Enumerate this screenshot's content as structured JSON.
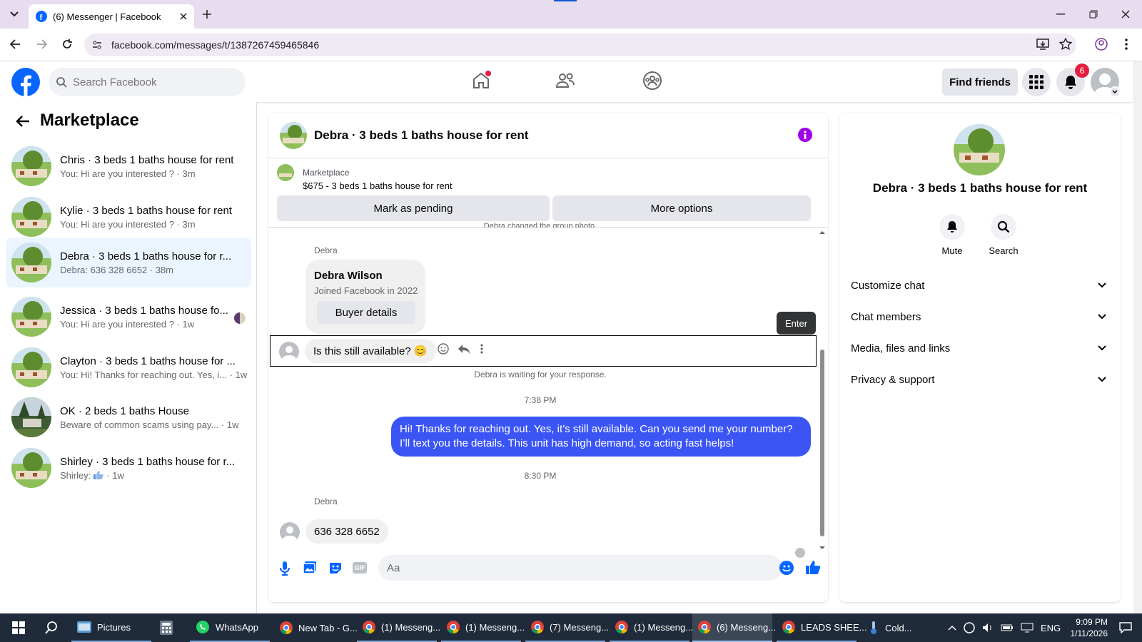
{
  "browser": {
    "tab_title": "(6) Messenger | Facebook",
    "new_tab_icon": "plus-icon",
    "url": "facebook.com/messages/t/1387267459465846"
  },
  "fb_header": {
    "search_placeholder": "Search Facebook",
    "find_friends": "Find friends",
    "notification_count": "6"
  },
  "sidebar": {
    "title": "Marketplace",
    "conversations": [
      {
        "name": "Chris · 3 beds 1 baths house for rent",
        "preview": "You: Hi are you interested ? · 3m"
      },
      {
        "name": "Kylie · 3 beds 1 baths house for rent",
        "preview": "You: Hi are you interested ? · 3m"
      },
      {
        "name": "Debra · 3 beds 1 baths house for r...",
        "preview": "Debra: 636 328 6652 · 38m"
      },
      {
        "name": "Jessica · 3 beds 1 baths house fo...",
        "preview": "You: Hi are you interested ? · 1w"
      },
      {
        "name": "Clayton · 3 beds 1 baths house for ...",
        "preview": "You: Hi! Thanks for reaching out. Yes, i... · 1w"
      },
      {
        "name": "OK · 2 beds 1 baths House",
        "preview": "Beware of common scams using pay... · 1w"
      },
      {
        "name": "Shirley · 3 beds 1 baths house for r...",
        "preview_prefix": "Shirley:",
        "preview_suffix": "· 1w"
      }
    ]
  },
  "chat": {
    "title": "Debra · 3 beds 1 baths house for rent",
    "listing_label": "Marketplace",
    "listing_price": "$675 - 3 beds 1 baths house for rent",
    "mark_pending": "Mark as pending",
    "more_options": "More options",
    "group_photo_note": "Debra changed the group photo.",
    "sender": "Debra",
    "profile_card": {
      "name": "Debra Wilson",
      "joined": "Joined Facebook in 2022",
      "button": "Buyer details"
    },
    "enter_tooltip": "Enter",
    "msg_available": "Is this still available? 😊",
    "waiting_note": "Debra is waiting for your response.",
    "time1": "7:38 PM",
    "outgoing": "Hi! Thanks for reaching out. Yes, it’s still available. Can you send me your number? I’ll text you the details. This unit has high demand, so acting fast helps!",
    "time2": "8:30 PM",
    "sender2": "Debra",
    "msg_number": "636 328 6652",
    "composer_placeholder": "Aa"
  },
  "right_panel": {
    "title": "Debra · 3 beds 1 baths house for rent",
    "mute": "Mute",
    "search": "Search",
    "sections": [
      "Customize chat",
      "Chat members",
      "Media, files and links",
      "Privacy & support"
    ]
  },
  "taskbar": {
    "items": [
      {
        "label": "Pictures"
      },
      {
        "label": "WhatsApp"
      },
      {
        "label": "New Tab - G..."
      },
      {
        "label": "(1) Messeng..."
      },
      {
        "label": "(1) Messeng..."
      },
      {
        "label": "(7) Messeng..."
      },
      {
        "label": "(1) Messeng..."
      },
      {
        "label": "(6) Messeng..."
      },
      {
        "label": "LEADS SHEE..."
      },
      {
        "label": "Cold..."
      }
    ],
    "language": "ENG",
    "time": "9:09 PM",
    "date": "1/11/2026"
  },
  "colors": {
    "fb_blue": "#0866ff",
    "outgoing_bubble": "#3b55f5",
    "badge_red": "#e41e3f",
    "info_purple": "#a200e5"
  }
}
